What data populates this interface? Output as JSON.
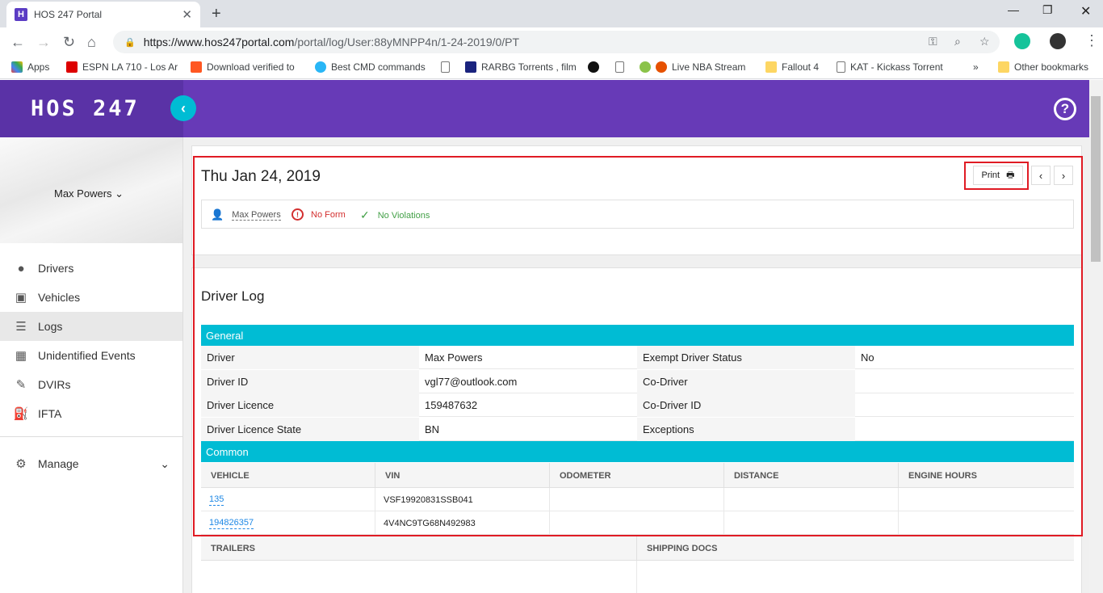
{
  "browser": {
    "tab_title": "HOS 247 Portal",
    "favicon_letter": "H",
    "url_host": "https://www.hos247portal.com",
    "url_path": "/portal/log/User:88yMNPP4n/1-24-2019/0/PT",
    "bookmarks": [
      "Apps",
      "ESPN LA 710 - Los Ar",
      "Download verified to",
      "Best CMD commands",
      "RARBG Torrents , film",
      "Live NBA Stream",
      "Fallout 4",
      "KAT - Kickass Torrent"
    ],
    "other_bookmarks": "Other bookmarks",
    "overflow": "»"
  },
  "app": {
    "logo": "HOS 247",
    "help_icon": "?",
    "user_name": "Max Powers",
    "nav": [
      {
        "label": "Drivers",
        "icon": "person-icon"
      },
      {
        "label": "Vehicles",
        "icon": "bus-icon"
      },
      {
        "label": "Logs",
        "icon": "list-icon"
      },
      {
        "label": "Unidentified Events",
        "icon": "calendar-icon"
      },
      {
        "label": "DVIRs",
        "icon": "wrench-icon"
      },
      {
        "label": "IFTA",
        "icon": "fuel-icon"
      }
    ],
    "manage": "Manage",
    "active_nav": "Logs"
  },
  "log": {
    "date_title": "Thu Jan 24, 2019",
    "print_label": "Print",
    "prev": "‹",
    "next": "›",
    "status": {
      "driver": "Max Powers",
      "form": "No Form",
      "violations": "No Violations"
    },
    "section_title": "Driver Log",
    "general_header": "General",
    "general_rows": [
      [
        "Driver",
        "Max Powers",
        "Exempt Driver Status",
        "No"
      ],
      [
        "Driver ID",
        "vgl77@outlook.com",
        "Co-Driver",
        ""
      ],
      [
        "Driver Licence",
        "159487632",
        "Co-Driver ID",
        ""
      ],
      [
        "Driver Licence State",
        "BN",
        "Exceptions",
        ""
      ]
    ],
    "common_header": "Common",
    "common_columns": [
      "VEHICLE",
      "VIN",
      "ODOMETER",
      "DISTANCE",
      "ENGINE HOURS"
    ],
    "common_rows": [
      [
        "135",
        "VSF19920831SSB041",
        "",
        "",
        ""
      ],
      [
        "194826357",
        "4V4NC9TG68N492983",
        "",
        "",
        ""
      ]
    ],
    "bottom_columns": [
      "TRAILERS",
      "SHIPPING DOCS"
    ]
  },
  "colors": {
    "appbar": "#673ab7",
    "accent": "#00bcd4",
    "highlight": "#e01b24"
  }
}
